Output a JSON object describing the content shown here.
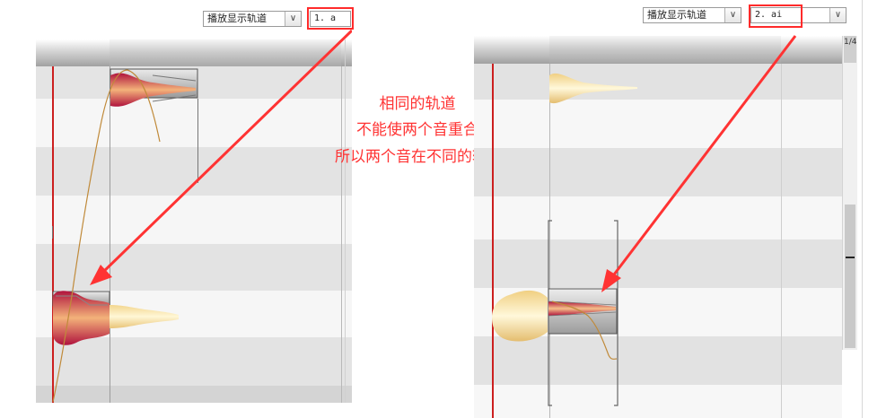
{
  "left_panel": {
    "dropdown_label": "播放显示轨道",
    "track_value": "1. a"
  },
  "right_panel": {
    "dropdown_label": "播放显示轨道",
    "track_value": "2. ai",
    "scroll_indicator": "1/4"
  },
  "annotation": {
    "lines": [
      "相同的轨道",
      "不能使两个音重合",
      "所以两个音在不同的轨道下"
    ]
  },
  "colors": {
    "accent_red": "#ff3333",
    "playhead": "#cc1f1f"
  }
}
